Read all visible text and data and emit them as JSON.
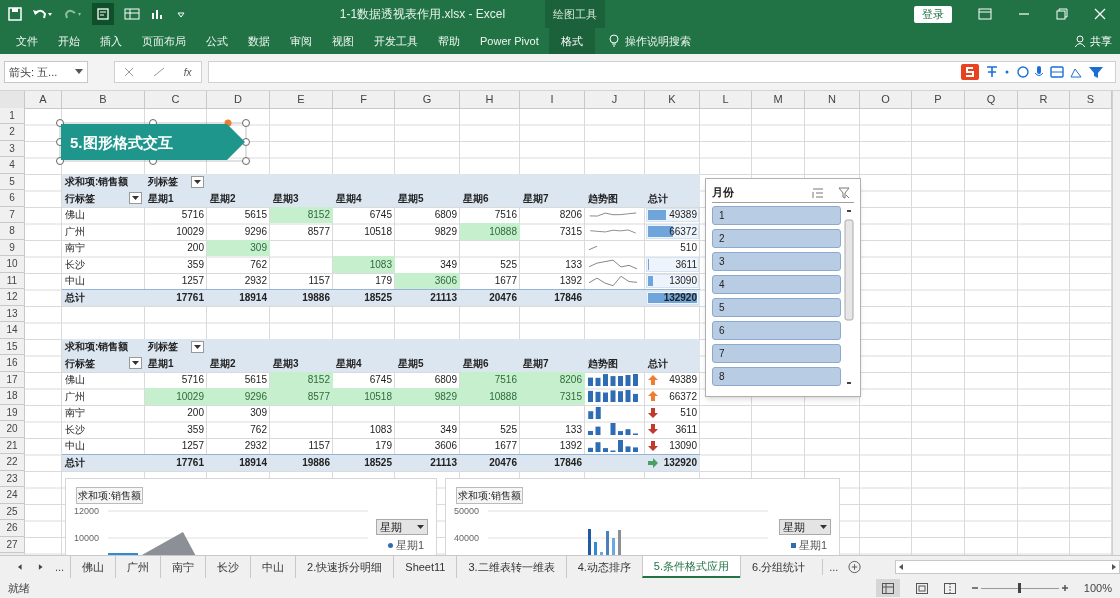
{
  "window": {
    "title": "1-1数据透视表作用.xlsx  -  Excel",
    "context_tab": "绘图工具",
    "login_button": "登录"
  },
  "ribbon_tabs": [
    {
      "label": "文件",
      "selected": false
    },
    {
      "label": "开始",
      "selected": false
    },
    {
      "label": "插入",
      "selected": false
    },
    {
      "label": "页面布局",
      "selected": false
    },
    {
      "label": "公式",
      "selected": false
    },
    {
      "label": "数据",
      "selected": false
    },
    {
      "label": "审阅",
      "selected": false
    },
    {
      "label": "视图",
      "selected": false
    },
    {
      "label": "开发工具",
      "selected": false
    },
    {
      "label": "帮助",
      "selected": false
    },
    {
      "label": "Power Pivot",
      "selected": false
    },
    {
      "label": "格式",
      "selected": true
    }
  ],
  "tell_me": "操作说明搜索",
  "share": "共享",
  "name_box": "箭头: 五...",
  "fx": "fx",
  "columns": [
    "A",
    "B",
    "C",
    "D",
    "E",
    "F",
    "G",
    "H",
    "I",
    "J",
    "K",
    "L",
    "M",
    "N",
    "O",
    "P",
    "Q",
    "R",
    "S"
  ],
  "row_numbers": [
    "1",
    "2",
    "3",
    "4",
    "5",
    "6",
    "7",
    "8",
    "9",
    "10",
    "11",
    "12",
    "13",
    "14",
    "15",
    "16",
    "17",
    "18",
    "19",
    "20",
    "21",
    "22",
    "23",
    "24",
    "25",
    "26",
    "27"
  ],
  "shape": {
    "text": "5.图形格式交互"
  },
  "pivots": [
    {
      "kind": "line",
      "header": "求和项:销售额",
      "column_label": "列标签",
      "row_label": "行标签",
      "columns": [
        "星期1",
        "星期2",
        "星期3",
        "星期4",
        "星期5",
        "星期6",
        "星期7"
      ],
      "trend": "趋势图",
      "total": "总计",
      "rows": [
        {
          "name": "佛山",
          "values": [
            {
              "text": "5716",
              "highlight": false
            },
            {
              "text": "5615",
              "highlight": false
            },
            {
              "text": "8152",
              "highlight": true
            },
            {
              "text": "6745",
              "highlight": false
            },
            {
              "text": "6809",
              "highlight": false
            },
            {
              "text": "7516",
              "highlight": false
            },
            {
              "text": "8206",
              "highlight": false
            }
          ],
          "total": "49389",
          "level": 0.37
        },
        {
          "name": "广州",
          "values": [
            {
              "text": "10029",
              "highlight": false
            },
            {
              "text": "9296",
              "highlight": false
            },
            {
              "text": "8577",
              "highlight": false
            },
            {
              "text": "10518",
              "highlight": false
            },
            {
              "text": "9829",
              "highlight": false
            },
            {
              "text": "10888",
              "highlight": true
            },
            {
              "text": "7315",
              "highlight": false
            }
          ],
          "total": "66372",
          "level": 0.5
        },
        {
          "name": "南宁",
          "values": [
            {
              "text": "200",
              "highlight": false
            },
            {
              "text": "309",
              "highlight": true
            },
            {
              "highlight": false
            },
            {
              "highlight": false
            },
            {
              "highlight": false
            },
            {
              "highlight": false
            },
            {
              "highlight": false
            }
          ],
          "total": "510"
        },
        {
          "name": "长沙",
          "values": [
            {
              "text": "359",
              "highlight": false
            },
            {
              "text": "762",
              "highlight": false
            },
            {
              "highlight": false
            },
            {
              "text": "1083",
              "highlight": true
            },
            {
              "text": "349",
              "highlight": false
            },
            {
              "text": "525",
              "highlight": false
            },
            {
              "text": "133",
              "highlight": false
            }
          ],
          "total": "3611",
          "level": 0.03
        },
        {
          "name": "中山",
          "values": [
            {
              "text": "1257",
              "highlight": false
            },
            {
              "text": "2932",
              "highlight": false
            },
            {
              "text": "1157",
              "highlight": false
            },
            {
              "text": "179",
              "highlight": false
            },
            {
              "text": "3606",
              "highlight": true
            },
            {
              "text": "1677",
              "highlight": false
            },
            {
              "text": "1392",
              "highlight": false
            }
          ],
          "total": "13090",
          "level": 0.1
        }
      ],
      "grand": {
        "name": "总计",
        "values": [
          {
            "text": "17761",
            "highlight": false
          },
          {
            "text": "18914",
            "highlight": false
          },
          {
            "text": "19886",
            "highlight": false
          },
          {
            "text": "18525",
            "highlight": false
          },
          {
            "text": "21113",
            "highlight": false
          },
          {
            "text": "20476",
            "highlight": false
          },
          {
            "text": "17846",
            "highlight": false
          }
        ],
        "total": "132920",
        "level": 1
      }
    },
    {
      "kind": "column",
      "header": "求和项:销售额",
      "column_label": "列标签",
      "row_label": "行标签",
      "columns": [
        "星期1",
        "星期2",
        "星期3",
        "星期4",
        "星期5",
        "星期6",
        "星期7"
      ],
      "trend": "趋势图",
      "total": "总计",
      "rows": [
        {
          "name": "佛山",
          "values": [
            {
              "text": "5716",
              "highlight": false
            },
            {
              "text": "5615",
              "highlight": false
            },
            {
              "text": "8152",
              "highlight": true
            },
            {
              "text": "6745",
              "highlight": false
            },
            {
              "text": "6809",
              "highlight": false
            },
            {
              "text": "7516",
              "highlight": true
            },
            {
              "text": "8206",
              "highlight": true
            }
          ],
          "total": "49389",
          "kind": "up"
        },
        {
          "name": "广州",
          "values": [
            {
              "text": "10029",
              "highlight": true
            },
            {
              "text": "9296",
              "highlight": true
            },
            {
              "text": "8577",
              "highlight": true
            },
            {
              "text": "10518",
              "highlight": true
            },
            {
              "text": "9829",
              "highlight": true
            },
            {
              "text": "10888",
              "highlight": true
            },
            {
              "text": "7315",
              "highlight": true
            }
          ],
          "total": "66372",
          "kind": "up"
        },
        {
          "name": "南宁",
          "values": [
            {
              "text": "200",
              "highlight": false
            },
            {
              "text": "309",
              "highlight": false
            },
            {
              "highlight": false
            },
            {
              "highlight": false
            },
            {
              "highlight": false
            },
            {
              "highlight": false
            },
            {
              "highlight": false
            }
          ],
          "total": "510",
          "kind": "down"
        },
        {
          "name": "长沙",
          "values": [
            {
              "text": "359",
              "highlight": false
            },
            {
              "text": "762",
              "highlight": false
            },
            {
              "highlight": false
            },
            {
              "text": "1083",
              "highlight": false
            },
            {
              "text": "349",
              "highlight": false
            },
            {
              "text": "525",
              "highlight": false
            },
            {
              "text": "133",
              "highlight": false
            }
          ],
          "total": "3611",
          "kind": "down"
        },
        {
          "name": "中山",
          "values": [
            {
              "text": "1257",
              "highlight": false
            },
            {
              "text": "2932",
              "highlight": false
            },
            {
              "text": "1157",
              "highlight": false
            },
            {
              "text": "179",
              "highlight": false
            },
            {
              "text": "3606",
              "highlight": false
            },
            {
              "text": "1677",
              "highlight": false
            },
            {
              "text": "1392",
              "highlight": false
            }
          ],
          "total": "13090",
          "kind": "down"
        }
      ],
      "grand": {
        "name": "总计",
        "values": [
          {
            "text": "17761",
            "highlight": false
          },
          {
            "text": "18914",
            "highlight": false
          },
          {
            "text": "19886",
            "highlight": false
          },
          {
            "text": "18525",
            "highlight": false
          },
          {
            "text": "21113",
            "highlight": false
          },
          {
            "text": "20476",
            "highlight": false
          },
          {
            "text": "17846",
            "highlight": false
          }
        ],
        "total": "132920",
        "kind": "flat"
      }
    }
  ],
  "slicer": {
    "title": "月份",
    "items": [
      {
        "label": "1",
        "selected": true
      },
      {
        "label": "2",
        "selected": true
      },
      {
        "label": "3",
        "selected": true
      },
      {
        "label": "4",
        "selected": true
      },
      {
        "label": "5",
        "selected": true
      },
      {
        "label": "6",
        "selected": true
      },
      {
        "label": "7",
        "selected": true
      },
      {
        "label": "8",
        "selected": true
      }
    ]
  },
  "charts": [
    {
      "kind": "area",
      "title": "求和项:销售额",
      "ticks": [
        "12000",
        "10000"
      ],
      "legend_button": "星期",
      "legend_item": "星期1"
    },
    {
      "kind": "bar",
      "title": "求和项:销售额",
      "ticks": [
        "50000",
        "40000"
      ],
      "legend_button": "星期",
      "legend_item": "星期1"
    }
  ],
  "sheet_tabs": [
    {
      "label": "佛山",
      "selected": false
    },
    {
      "label": "广州",
      "selected": false
    },
    {
      "label": "南宁",
      "selected": false
    },
    {
      "label": "长沙",
      "selected": false
    },
    {
      "label": "中山",
      "selected": false
    },
    {
      "label": "2.快速拆分明细",
      "selected": false
    },
    {
      "label": "Sheet11",
      "selected": false
    },
    {
      "label": "3.二维表转一维表",
      "selected": false
    },
    {
      "label": "4.动态排序",
      "selected": false
    },
    {
      "label": "5.条件格式应用",
      "selected": true
    },
    {
      "label": "6.分组统计",
      "selected": false
    }
  ],
  "tabs_more_left": "...",
  "tabs_more_right": "...",
  "status": "就绪",
  "zoom_slider": {
    "level": 0.5
  },
  "zoom": "100%"
}
